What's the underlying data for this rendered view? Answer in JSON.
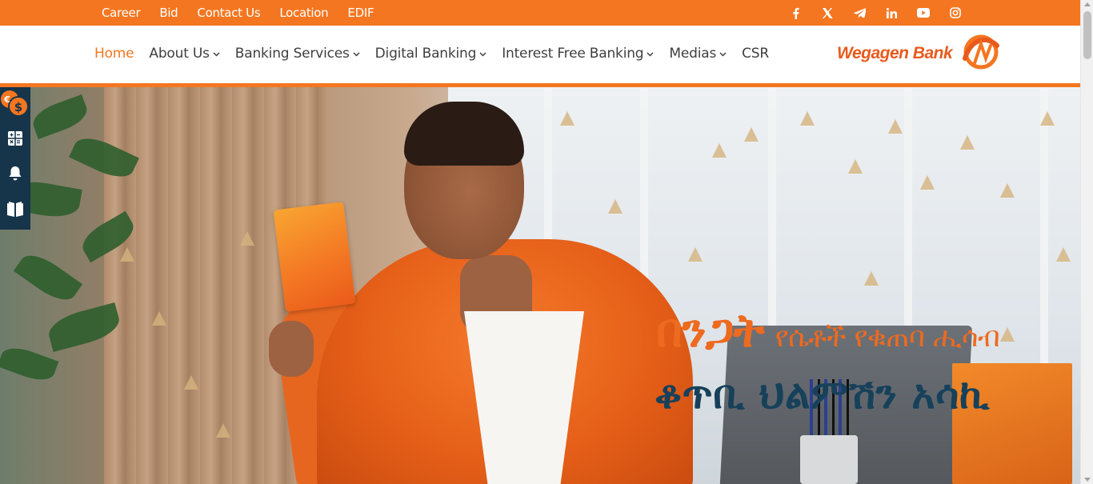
{
  "top_bar": {
    "links": [
      "Career",
      "Bid",
      "Contact Us",
      "Location",
      "EDIF"
    ],
    "social_icons": [
      "facebook-icon",
      "x-icon",
      "telegram-icon",
      "linkedin-icon",
      "youtube-icon",
      "instagram-icon"
    ],
    "background_color": "#f47620"
  },
  "nav": {
    "items": [
      {
        "label": "Home",
        "active": true,
        "has_dropdown": false
      },
      {
        "label": "About Us",
        "active": false,
        "has_dropdown": true
      },
      {
        "label": "Banking Services",
        "active": false,
        "has_dropdown": true
      },
      {
        "label": "Digital Banking",
        "active": false,
        "has_dropdown": true
      },
      {
        "label": "Interest Free Banking",
        "active": false,
        "has_dropdown": true
      },
      {
        "label": "Medias",
        "active": false,
        "has_dropdown": true
      },
      {
        "label": "CSR",
        "active": false,
        "has_dropdown": false
      }
    ],
    "active_color": "#f47620"
  },
  "logo": {
    "text": "Wegagen Bank",
    "color": "#e85a1c"
  },
  "hero": {
    "headline_big": "በንጋት",
    "headline_small": "የሴቶች የቁጠባ ሒሳብ",
    "headline_line2": "ቆጥቢ ህልምሽን አሳኪ",
    "headline_orange": "#ee6a1f",
    "headline_blue": "#17415a"
  },
  "side_tools": {
    "icons": [
      "currency-exchange-icon",
      "calculator-icon",
      "bell-icon",
      "book-icon"
    ],
    "background_color": "#16344a"
  }
}
